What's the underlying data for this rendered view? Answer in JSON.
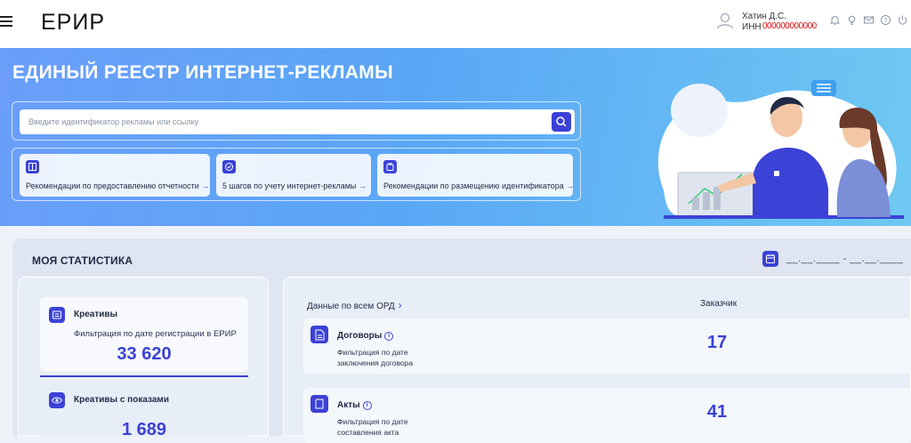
{
  "header": {
    "logo": "ЕРИР",
    "user_name": "Хатин Д.С.",
    "inn_label": "ИНН",
    "inn_value": "000000000000",
    "icons": [
      "bell-icon",
      "lightbulb-icon",
      "mail-icon",
      "help-icon",
      "power-icon"
    ]
  },
  "hero": {
    "title": "ЕДИНЫЙ РЕЕСТР ИНТЕРНЕТ-РЕКЛАМЫ",
    "search_placeholder": "Введите идентификатор рекламы или ссылку",
    "quick_links": [
      {
        "label": "Рекомендации по предоставлению отчетности",
        "arrow": "→",
        "icon": "book-icon"
      },
      {
        "label": "5 шагов по учету интернет-рекламы",
        "arrow": "→",
        "icon": "check-circle-icon"
      },
      {
        "label": "Рекомендации по размещению идентификатора",
        "arrow": "→",
        "icon": "bag-icon"
      }
    ]
  },
  "stats": {
    "title": "МОЯ СТАТИСТИКА",
    "date_range": "__.__.____ - __.__.____",
    "left": [
      {
        "title": "Креативы",
        "subtitle": "Фильтрация по дате регистрации в ЕРИР",
        "value": "33 620",
        "icon": "creative-icon"
      },
      {
        "title": "Креативы с показами",
        "value": "1 689",
        "icon": "eye-icon"
      }
    ],
    "right": {
      "header_left": "Данные по всем ОРД",
      "header_left_chevron": "›",
      "header_right": "Заказчик",
      "rows": [
        {
          "title": "Договоры",
          "info": "i",
          "subtitle": "Фильтрация по дате заключения договора",
          "value": "17",
          "icon": "contract-icon"
        },
        {
          "title": "Акты",
          "info": "i",
          "subtitle": "Фильтрация по дате составления акта",
          "value": "41",
          "icon": "act-icon"
        }
      ]
    }
  },
  "colors": {
    "accent": "#3b42d6",
    "hero_gradient_start": "#6a9ef8",
    "hero_gradient_end": "#6fc9f2",
    "panel_bg": "#dfe6f2"
  }
}
